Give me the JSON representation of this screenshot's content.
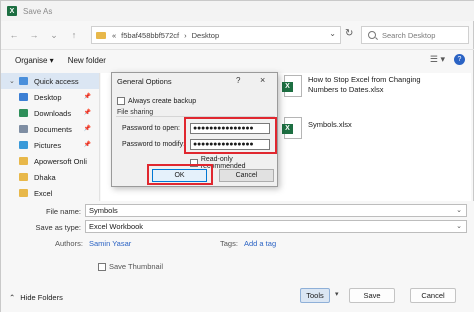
{
  "window": {
    "title": "Save As",
    "app_icon_letter": "X"
  },
  "nav": {
    "back": "←",
    "forward": "→",
    "up_menu": "⌄",
    "up": "↑",
    "path": [
      "«",
      "f5baf458bbf572cf",
      "›",
      "Desktop"
    ],
    "refresh": "↻",
    "search_placeholder": "Search Desktop"
  },
  "toolbar": {
    "organise": "Organise ▾",
    "new_folder": "New folder",
    "view": "☰ ▾",
    "help": "?"
  },
  "sidebar": {
    "items": [
      {
        "label": "Quick access",
        "color": "#4a8fdb",
        "pinned": false,
        "expand": "⌄",
        "active": true
      },
      {
        "label": "Desktop",
        "color": "#3c7fd4",
        "pinned": true
      },
      {
        "label": "Downloads",
        "color": "#2f8f5a",
        "pinned": true
      },
      {
        "label": "Documents",
        "color": "#7f8ea3",
        "pinned": true
      },
      {
        "label": "Pictures",
        "color": "#3a9ad9",
        "pinned": true
      },
      {
        "label": "Apowersoft Onli",
        "color": "#e8b84a",
        "pinned": false
      },
      {
        "label": "Dhaka",
        "color": "#e8b84a",
        "pinned": false
      },
      {
        "label": "Excel",
        "color": "#e8b84a",
        "pinned": false
      }
    ]
  },
  "files": [
    {
      "name_line1": "How to Stop Excel from Changing",
      "name_line2": "Numbers to Dates.xlsx"
    },
    {
      "name_line1": "Symbols.xlsx",
      "name_line2": ""
    }
  ],
  "form": {
    "file_name_label": "File name:",
    "file_name": "Symbols",
    "save_type_label": "Save as type:",
    "save_type": "Excel Workbook",
    "authors_label": "Authors:",
    "authors": "Samin Yasar",
    "tags_label": "Tags:",
    "tags": "Add a tag",
    "thumbnail": "Save Thumbnail"
  },
  "bottom": {
    "hide_folders": "Hide Folders",
    "tools": "Tools",
    "tools_chev": "▾",
    "save": "Save",
    "cancel": "Cancel"
  },
  "dialog": {
    "title": "General Options",
    "help": "?",
    "close": "×",
    "always_backup": "Always create backup",
    "file_sharing": "File sharing",
    "pwd_open_label": "Password to open:",
    "pwd_open": "●●●●●●●●●●●●●●●",
    "pwd_modify_label": "Password to modify:",
    "pwd_modify": "●●●●●●●●●●●●●●●",
    "read_only": "Read-only recommended",
    "ok": "OK",
    "cancel": "Cancel"
  },
  "colors": {
    "excel_green": "#1d6f42",
    "highlight_red": "#e0272f",
    "accent_blue": "#0078d4"
  }
}
